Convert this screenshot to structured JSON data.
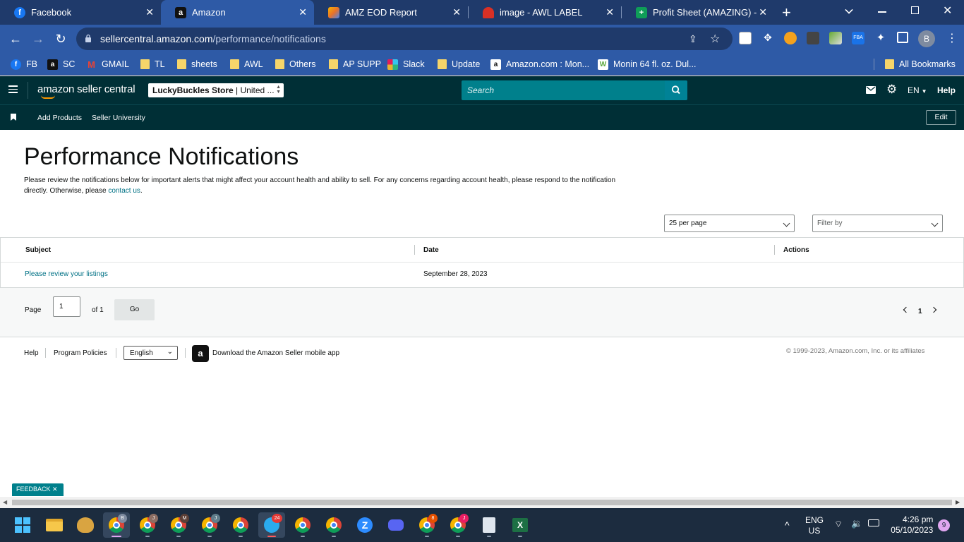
{
  "browser": {
    "tabs": [
      {
        "title": "Facebook",
        "favicon_color": "#1877f2",
        "favicon_glyph": "f"
      },
      {
        "title": "Amazon",
        "favicon_color": "#111111",
        "favicon_glyph": "a"
      },
      {
        "title": "AMZ EOD Report",
        "favicon_color": "#e8712b",
        "favicon_glyph": ""
      },
      {
        "title": "image - AWL LABEL",
        "favicon_color": "#d93025",
        "favicon_glyph": ""
      },
      {
        "title": "Profit Sheet (AMAZING) - Go",
        "favicon_color": "#0f9d58",
        "favicon_glyph": "+"
      }
    ],
    "new_tab_label": "+",
    "url_host": "sellercentral.amazon.com",
    "url_path": "/performance/notifications",
    "profile_initial": "B",
    "bookmarks": [
      {
        "label": "FB",
        "icon": "facebook-icon",
        "color": "#1877f2",
        "glyph": "f"
      },
      {
        "label": "SC",
        "icon": "amazon-icon",
        "color": "#111111",
        "glyph": "a"
      },
      {
        "label": "GMAIL",
        "icon": "gmail-icon",
        "color": "#ea4335",
        "glyph": "M"
      },
      {
        "label": "TL",
        "icon": "folder-icon"
      },
      {
        "label": "sheets",
        "icon": "folder-icon"
      },
      {
        "label": "AWL",
        "icon": "folder-icon"
      },
      {
        "label": "Others",
        "icon": "folder-icon"
      },
      {
        "label": "AP SUPP",
        "icon": "folder-icon"
      },
      {
        "label": "Slack",
        "icon": "slack-icon",
        "color": "#e01e5a",
        "glyph": "#"
      },
      {
        "label": "Update",
        "icon": "folder-icon"
      },
      {
        "label": "Amazon.com : Mon...",
        "icon": "amazon-icon",
        "color": "#ffffff",
        "glyph": "a"
      },
      {
        "label": "Monin 64 fl. oz. Dul...",
        "icon": "w-icon",
        "color": "#5aa63c",
        "glyph": "W"
      }
    ],
    "all_bookmarks_label": "All Bookmarks"
  },
  "header": {
    "logo_text": "amazon seller central",
    "store_name": "LuckyBuckles Store",
    "store_suffix": " | United ...",
    "search_placeholder": "Search",
    "language": "EN",
    "help_label": "Help",
    "subnav": {
      "items": [
        "Add Products",
        "Seller University"
      ],
      "edit_label": "Edit"
    }
  },
  "main": {
    "title": "Performance Notifications",
    "intro_text": "Please review the notifications below for important alerts that might affect your account health and ability to sell. For any concerns regarding account health, please respond to the notification directly. Otherwise, please ",
    "contact_link": "contact us",
    "intro_end": ".",
    "per_page": "25 per page",
    "filter_placeholder": "Filter by",
    "table": {
      "headers": [
        "Subject",
        "Date",
        "Actions"
      ],
      "rows": [
        {
          "subject": "Please review your listings",
          "date": "September 28, 2023",
          "actions": ""
        }
      ]
    },
    "pager": {
      "page_label": "Page",
      "page_value": "1",
      "of_label": "of 1",
      "go_label": "Go",
      "current_page": "1"
    }
  },
  "footer": {
    "help": "Help",
    "policies": "Program Policies",
    "language": "English",
    "app_text": "Download the Amazon Seller mobile app",
    "copyright": "© 1999-2023, Amazon.com, Inc. or its affiliates"
  },
  "feedback_label": "FEEDBACK",
  "taskbar": {
    "lang_top": "ENG",
    "lang_bottom": "US",
    "time": "4:26 pm",
    "date": "05/10/2023",
    "notification_count": "9",
    "telegram_badge": "24"
  },
  "colors": {
    "header_bg": "#002f36",
    "link": "#007185",
    "search_bg": "#00808c"
  }
}
